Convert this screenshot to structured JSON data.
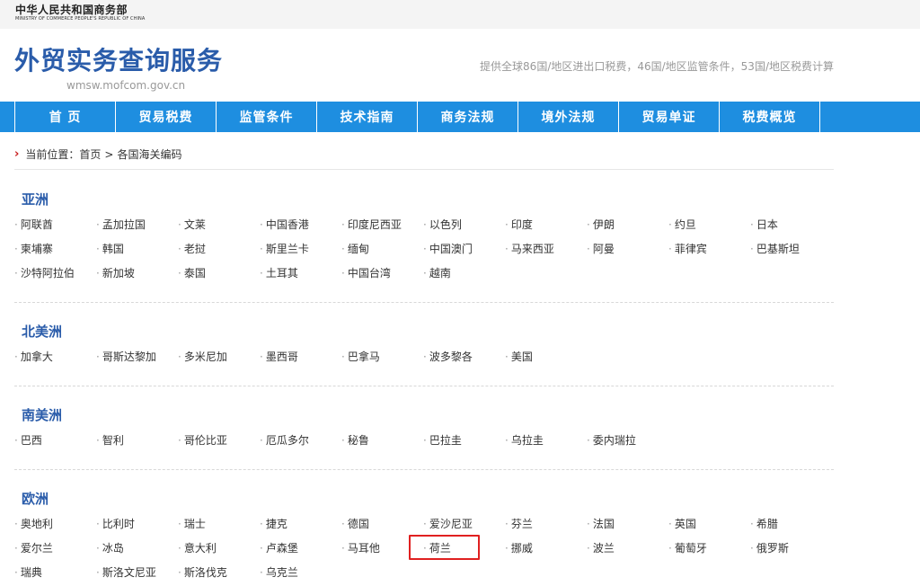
{
  "ministry": {
    "name_cn": "中华人民共和国商务部",
    "name_en": "MINISTRY OF COMMERCE PEOPLE'S REPUBLIC OF CHINA"
  },
  "header": {
    "title": "外贸实务查询服务",
    "url": "wmsw.mofcom.gov.cn",
    "slogan": "提供全球86国/地区进出口税费，46国/地区监管条件，53国/地区税费计算"
  },
  "nav": [
    "首 页",
    "贸易税费",
    "监管条件",
    "技术指南",
    "商务法规",
    "境外法规",
    "贸易单证",
    "税费概览"
  ],
  "breadcrumb": {
    "label": "当前位置：",
    "home": "首页",
    "separator": ">",
    "current": "各国海关编码"
  },
  "regions": [
    {
      "title": "亚洲",
      "countries": [
        "阿联酋",
        "孟加拉国",
        "文莱",
        "中国香港",
        "印度尼西亚",
        "以色列",
        "印度",
        "伊朗",
        "约旦",
        "日本",
        "柬埔寨",
        "韩国",
        "老挝",
        "斯里兰卡",
        "缅甸",
        "中国澳门",
        "马来西亚",
        "阿曼",
        "菲律宾",
        "巴基斯坦",
        "沙特阿拉伯",
        "新加坡",
        "泰国",
        "土耳其",
        "中国台湾",
        "越南"
      ]
    },
    {
      "title": "北美洲",
      "countries": [
        "加拿大",
        "哥斯达黎加",
        "多米尼加",
        "墨西哥",
        "巴拿马",
        "波多黎各",
        "美国"
      ]
    },
    {
      "title": "南美洲",
      "countries": [
        "巴西",
        "智利",
        "哥伦比亚",
        "厄瓜多尔",
        "秘鲁",
        "巴拉圭",
        "乌拉圭",
        "委内瑞拉"
      ]
    },
    {
      "title": "欧洲",
      "countries": [
        "奥地利",
        "比利时",
        "瑞士",
        "捷克",
        "德国",
        "爱沙尼亚",
        "芬兰",
        "法国",
        "英国",
        "希腊",
        "爱尔兰",
        "冰岛",
        "意大利",
        "卢森堡",
        "马耳他",
        "荷兰",
        "挪威",
        "波兰",
        "葡萄牙",
        "俄罗斯",
        "瑞典",
        "斯洛文尼亚",
        "斯洛伐克",
        "乌克兰"
      ]
    }
  ],
  "highlighted_country": "荷兰",
  "colors": {
    "nav": "#1e8ee0",
    "title": "#2a5caa",
    "highlight": "#e02020",
    "breadcrumb_arrow": "#c81d1d"
  }
}
